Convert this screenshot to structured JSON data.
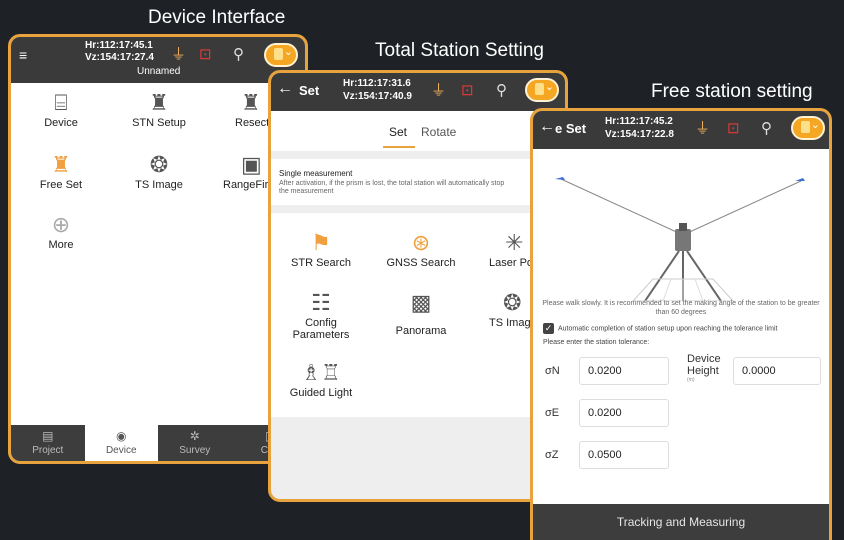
{
  "captions": {
    "device": "Device Interface",
    "total": "Total Station Setting",
    "free": "Free station setting"
  },
  "colors": {
    "accent": "#e8a33d",
    "titlebar": "#3a3a3a",
    "background": "#1e2227"
  },
  "device_screen": {
    "hz": "Hr:112:17:45.1",
    "vz": "Vz:154:17:27.4",
    "project_name": "Unnamed",
    "items": [
      {
        "label": "Device",
        "icon": "device-icon"
      },
      {
        "label": "STN Setup",
        "icon": "station-setup-icon"
      },
      {
        "label": "Resecti",
        "icon": "resection-icon"
      },
      {
        "label": "Free Set",
        "icon": "free-set-icon"
      },
      {
        "label": "TS Image",
        "icon": "camera-shutter-icon"
      },
      {
        "label": "RangeFir",
        "icon": "range-finder-icon"
      },
      {
        "label": "More",
        "icon": "plus-icon"
      }
    ],
    "tabs": [
      {
        "label": "Project",
        "icon": "project-icon"
      },
      {
        "label": "Device",
        "icon": "device-tab-icon"
      },
      {
        "label": "Survey",
        "icon": "survey-icon"
      },
      {
        "label": "CO",
        "icon": "cogo-icon"
      }
    ]
  },
  "total_screen": {
    "title": "Set",
    "hz": "Hr:112:17:31.6",
    "vz": "Vz:154:17:40.9",
    "tabs": [
      "Set",
      "Rotate"
    ],
    "section_title": "Single measurement",
    "section_desc": "After activation, if the prism is lost, the total station will automatically stop the measurement",
    "items": [
      {
        "label": "STR Search",
        "icon": "str-search-icon"
      },
      {
        "label": "GNSS Search",
        "icon": "gnss-search-icon"
      },
      {
        "label": "Laser Poin",
        "icon": "laser-pointer-icon"
      },
      {
        "label": "Config Parameters",
        "icon": "config-parameters-icon"
      },
      {
        "label": "Panorama",
        "icon": "panorama-icon"
      },
      {
        "label": "TS Imag",
        "icon": "ts-image-icon"
      },
      {
        "label": "Guided Light",
        "icon": "guided-light-icon"
      }
    ]
  },
  "free_screen": {
    "title": "e Set",
    "hz": "Hr:112:17:45.2",
    "vz": "Vz:154:17:22.8",
    "hint": "Please walk slowly. It is recommended to set the making angle of the station to be greater than 60 degrees",
    "checkbox_label": "Automatic completion of station setup upon reaching the tolerance limit",
    "tolerance_prompt": "Please enter the station tolerance:",
    "fields": [
      {
        "label": "σN",
        "value": "0.0200"
      },
      {
        "label": "σE",
        "value": "0.0200"
      },
      {
        "label": "σZ",
        "value": "0.0500"
      }
    ],
    "device_height_label": "Device Height",
    "device_height_unit": "(m)",
    "device_height_value": "0.0000",
    "action": "Tracking and Measuring"
  }
}
